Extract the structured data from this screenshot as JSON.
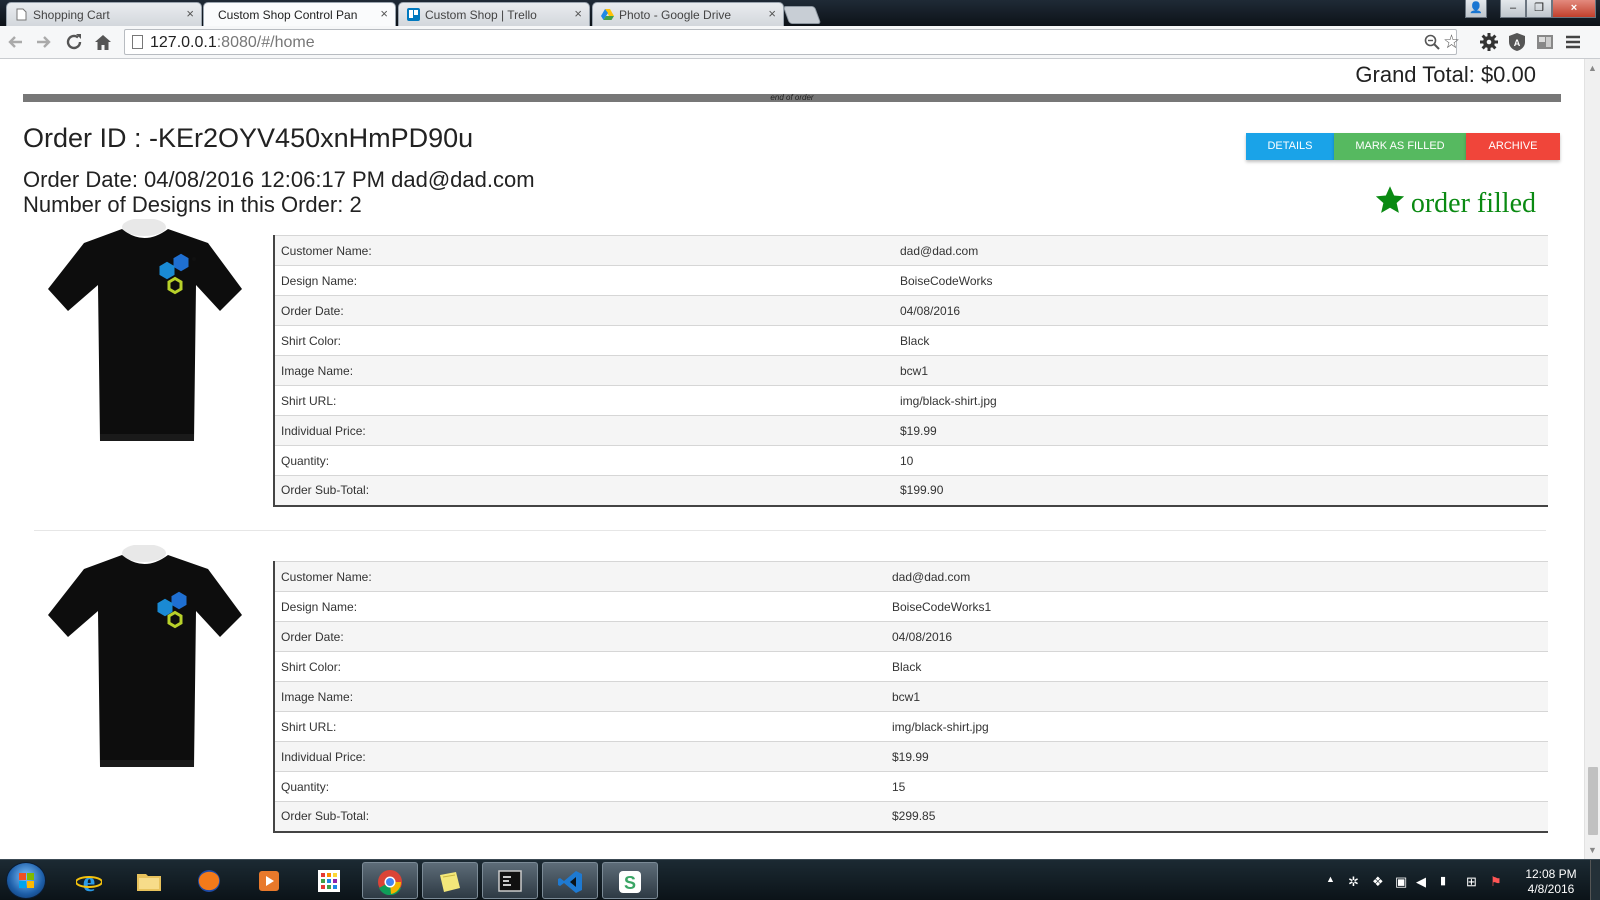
{
  "browser": {
    "tabs": [
      {
        "title": "Shopping Cart",
        "icon": "page-icon",
        "active": false
      },
      {
        "title": "Custom Shop Control Pan",
        "icon": "page-icon",
        "active": true
      },
      {
        "title": "Custom Shop | Trello",
        "icon": "trello-icon",
        "active": false
      },
      {
        "title": "Photo - Google Drive",
        "icon": "google-drive-icon",
        "active": false
      }
    ],
    "url_host": "127.0.0.1",
    "url_rest": ":8080/#/home",
    "close_glyph": "×",
    "min_glyph": "–",
    "max_glyph": "❐",
    "user_glyph": "👤"
  },
  "page": {
    "grand_total": "Grand Total: $0.00",
    "end_of_order": "end of order",
    "order": {
      "id": "Order ID : -KEr2OYV450xnHmPD90u",
      "date_line": "Order Date: 04/08/2016 12:06:17 PM dad@dad.com",
      "count_line": "Number of Designs in this Order: 2",
      "status": "order filled",
      "buttons": {
        "details": "DETAILS",
        "mark_filled": "MARK AS FILLED",
        "archive": "ARCHIVE"
      },
      "designs": [
        {
          "rows": [
            {
              "label": "Customer Name:",
              "value": "dad@dad.com"
            },
            {
              "label": "Design Name:",
              "value": "BoiseCodeWorks"
            },
            {
              "label": "Order Date:",
              "value": "04/08/2016"
            },
            {
              "label": "Shirt Color:",
              "value": "Black"
            },
            {
              "label": "Image Name:",
              "value": "bcw1"
            },
            {
              "label": "Shirt URL:",
              "value": "img/black-shirt.jpg"
            },
            {
              "label": "Individual Price:",
              "value": "$19.99"
            },
            {
              "label": "Quantity:",
              "value": "10"
            },
            {
              "label": "Order Sub-Total:",
              "value": "$199.90"
            }
          ]
        },
        {
          "rows": [
            {
              "label": "Customer Name:",
              "value": "dad@dad.com"
            },
            {
              "label": "Design Name:",
              "value": "BoiseCodeWorks1"
            },
            {
              "label": "Order Date:",
              "value": "04/08/2016"
            },
            {
              "label": "Shirt Color:",
              "value": "Black"
            },
            {
              "label": "Image Name:",
              "value": "bcw1"
            },
            {
              "label": "Shirt URL:",
              "value": "img/black-shirt.jpg"
            },
            {
              "label": "Individual Price:",
              "value": "$19.99"
            },
            {
              "label": "Quantity:",
              "value": "15"
            },
            {
              "label": "Order Sub-Total:",
              "value": "$299.85"
            }
          ]
        }
      ]
    }
  },
  "taskbar": {
    "apps": [
      "internet-explorer",
      "file-explorer",
      "firefox",
      "media-player",
      "app-grid",
      "chrome",
      "sticky-notes",
      "console",
      "visual-studio",
      "slack"
    ],
    "clock_time": "12:08 PM",
    "clock_date": "4/8/2016"
  },
  "colors": {
    "details": "#1aa3e8",
    "mark_filled": "#56b960",
    "archive": "#f0453a",
    "filled_status": "#0a8a12"
  }
}
